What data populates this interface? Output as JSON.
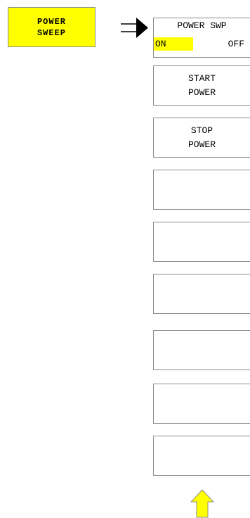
{
  "hardkey": {
    "line1": "POWER",
    "line2": "SWEEP"
  },
  "softkeys": [
    {
      "line1": "POWER SWP",
      "on": "ON",
      "off": "OFF"
    },
    {
      "line1": "START",
      "line2": "POWER"
    },
    {
      "line1": "STOP",
      "line2": "POWER"
    },
    {
      "line1": "",
      "line2": ""
    },
    {
      "line1": "",
      "line2": ""
    },
    {
      "line1": "",
      "line2": ""
    },
    {
      "line1": "",
      "line2": ""
    },
    {
      "line1": "",
      "line2": ""
    },
    {
      "line1": "",
      "line2": ""
    }
  ],
  "icons": {
    "pointer": "right-arrow-icon",
    "more": "up-arrow-icon"
  },
  "colors": {
    "highlight": "#ffff00",
    "border": "#8c8c8c"
  }
}
